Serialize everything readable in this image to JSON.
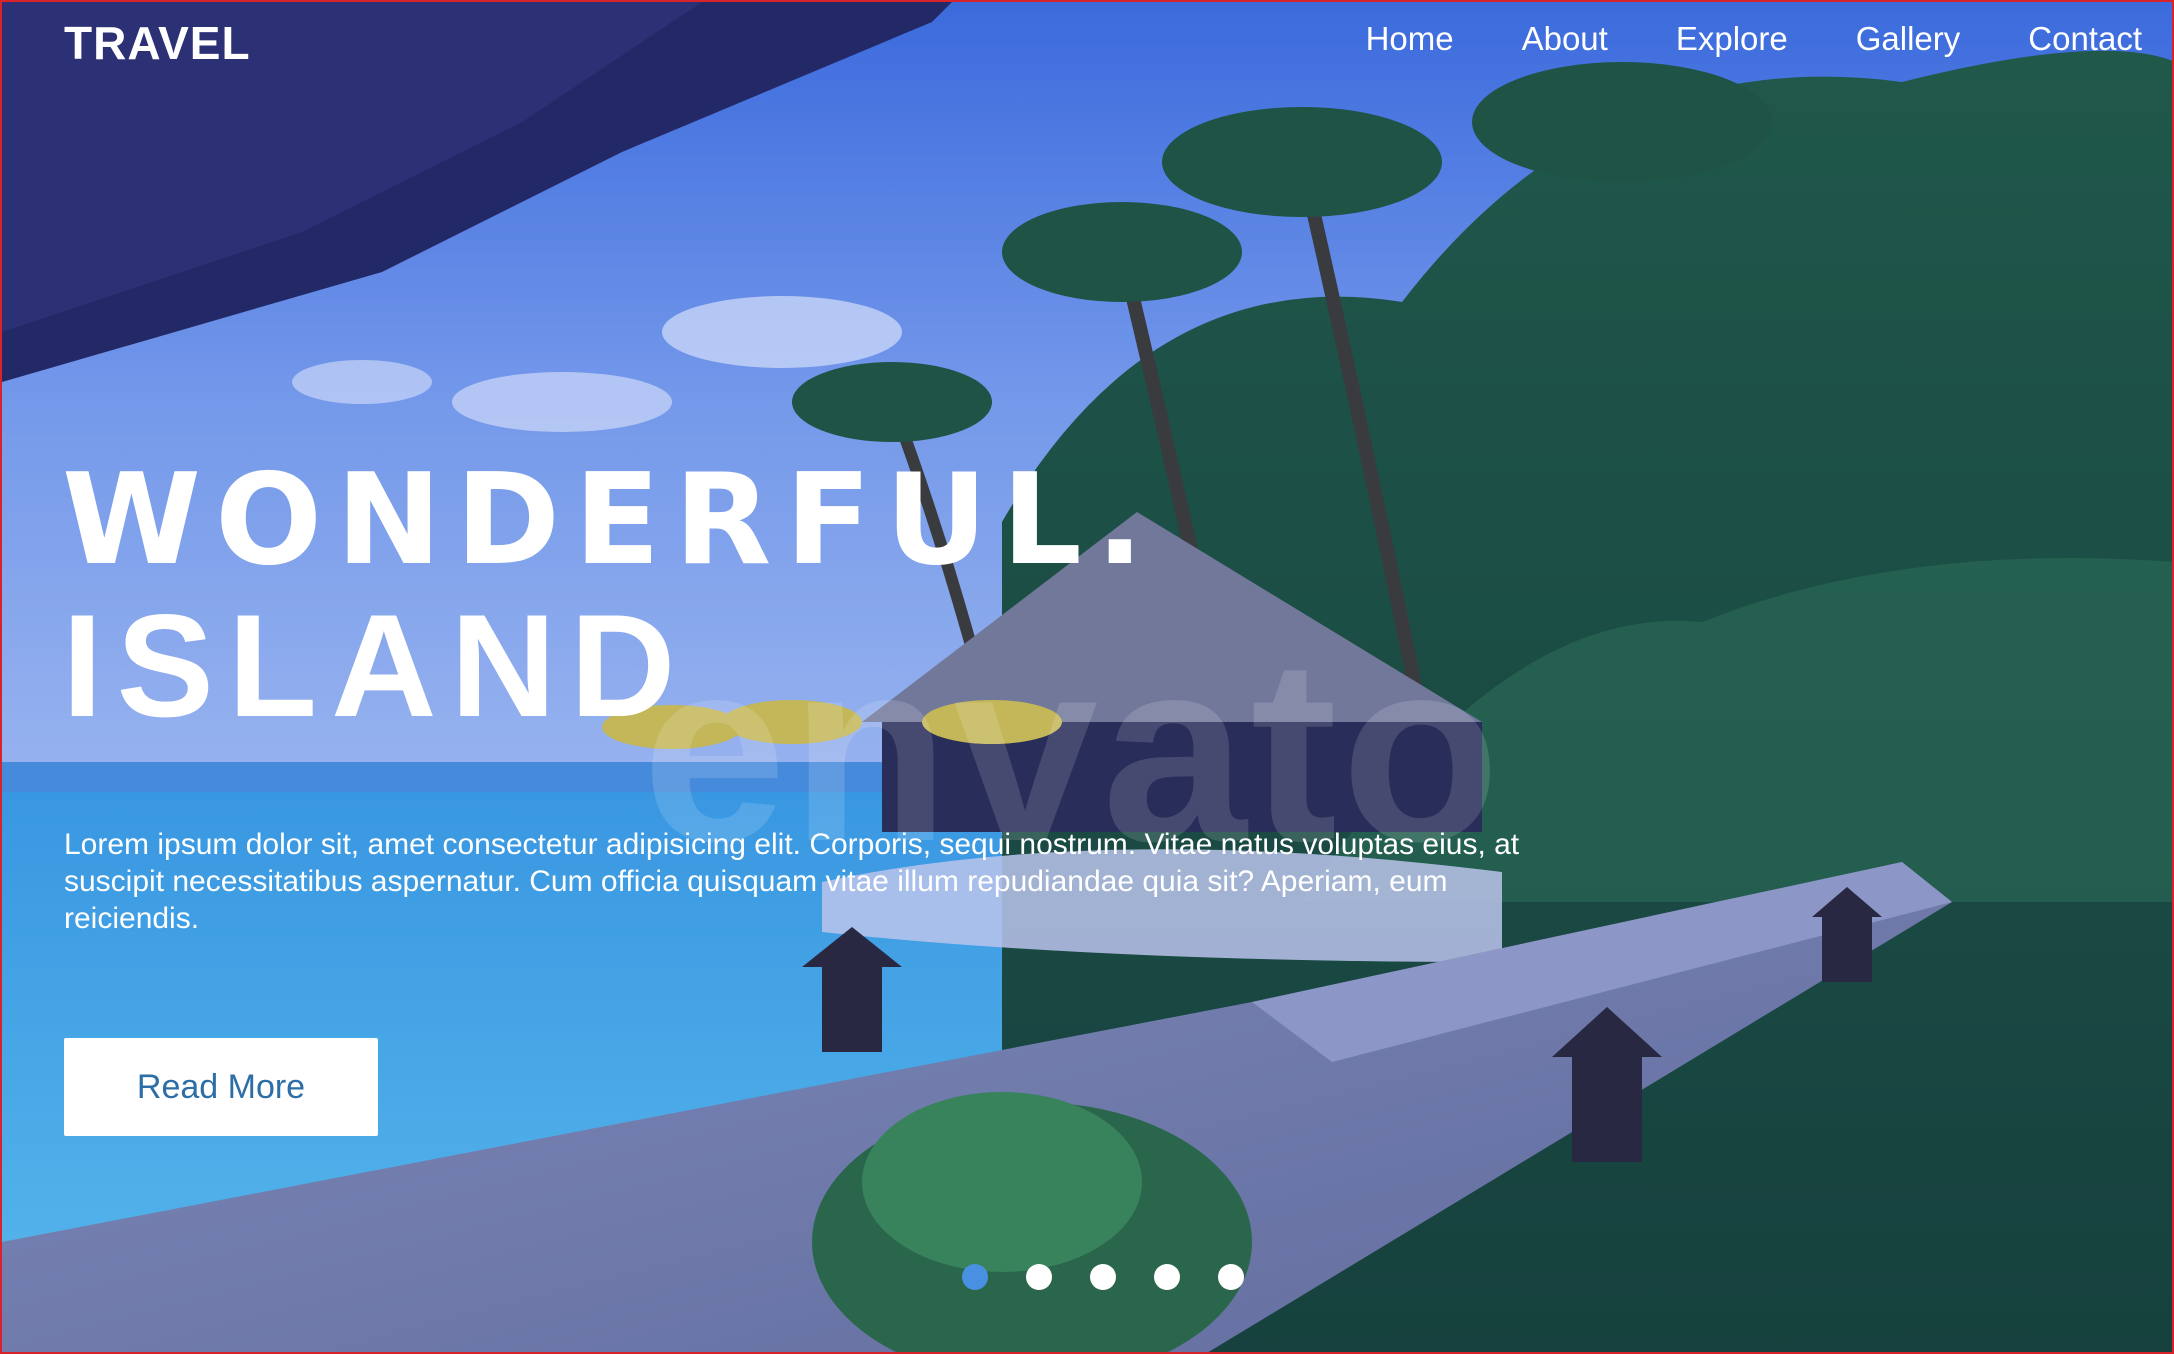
{
  "brand": "TRAVEL",
  "nav": {
    "items": [
      {
        "label": "Home"
      },
      {
        "label": "About"
      },
      {
        "label": "Explore"
      },
      {
        "label": "Gallery"
      },
      {
        "label": "Contact"
      }
    ]
  },
  "hero": {
    "headline_line1": "WONDERFUL.",
    "headline_line2": "ISLAND",
    "body": "Lorem ipsum dolor sit, amet consectetur adipisicing elit. Corporis, sequi nostrum. Vitae natus voluptas eius, at suscipit necessitatibus aspernatur. Cum officia quisquam vitae illum repudiandae quia sit? Aperiam, eum reiciendis.",
    "cta_label": "Read More",
    "watermark": "envato"
  },
  "slider": {
    "count": 5,
    "active_index": 0
  },
  "colors": {
    "active_dot": "#4a90e2",
    "cta_text": "#2c6ea5",
    "frame_border": "#d8232a"
  }
}
